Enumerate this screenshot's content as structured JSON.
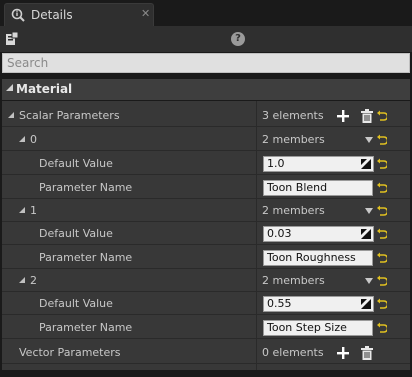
{
  "tab": {
    "title": "Details",
    "close": "✕"
  },
  "toolbar": {
    "help": "?"
  },
  "search": {
    "placeholder": "Search"
  },
  "category": {
    "label": "Material"
  },
  "scalar": {
    "label": "Scalar Parameters",
    "count": "3 elements"
  },
  "items": [
    {
      "index": "0",
      "members": "2 members",
      "default_label": "Default Value",
      "default_value": "1.0",
      "name_label": "Parameter Name",
      "name_value": "Toon Blend"
    },
    {
      "index": "1",
      "members": "2 members",
      "default_label": "Default Value",
      "default_value": "0.03",
      "name_label": "Parameter Name",
      "name_value": "Toon Roughness"
    },
    {
      "index": "2",
      "members": "2 members",
      "default_label": "Default Value",
      "default_value": "0.55",
      "name_label": "Parameter Name",
      "name_value": "Toon Step Size"
    }
  ],
  "vector": {
    "label": "Vector Parameters",
    "count": "0 elements"
  },
  "colors": {
    "accent_reset": "#e0c020",
    "icon_white": "#ffffff"
  }
}
